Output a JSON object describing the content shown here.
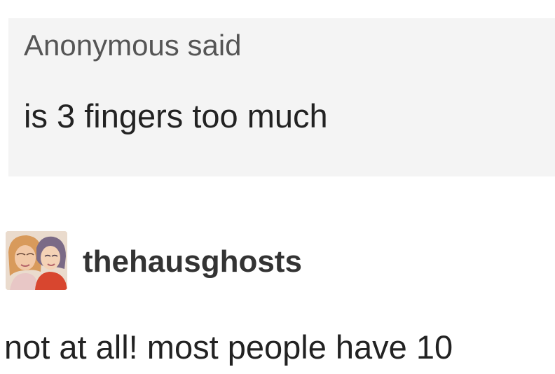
{
  "ask": {
    "asker": "Anonymous",
    "said_label": "said",
    "question": "is 3 fingers too much"
  },
  "answer": {
    "username": "thehausghosts",
    "avatar_icon": "user-avatar-illustration",
    "text": "not at all! most people have 10"
  }
}
